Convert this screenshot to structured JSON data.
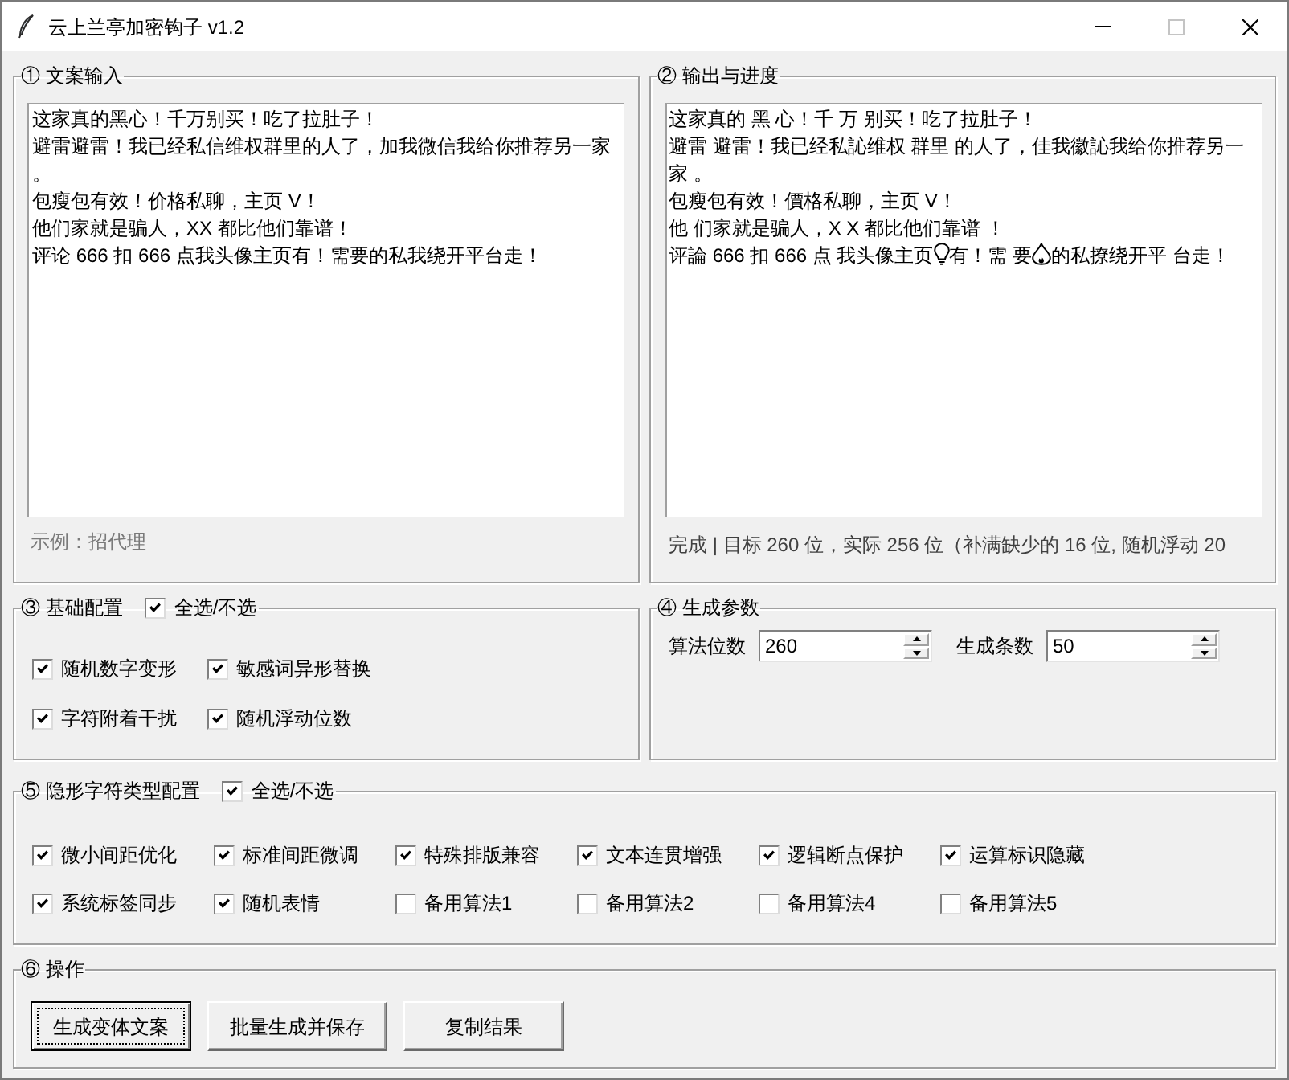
{
  "window": {
    "title": "云上兰亭加密钩子 v1.2",
    "controls": [
      {
        "kind": "minimize",
        "disabled": false
      },
      {
        "kind": "maximize",
        "disabled": true
      },
      {
        "kind": "close",
        "disabled": false
      }
    ]
  },
  "input_frame": {
    "title": "① 文案输入",
    "lines": [
      "这家真的黑心！千万别买！吃了拉肚子！",
      "避雷避雷！我已经私信维权群里的人了，加我微信我给你推荐另一家",
      "。",
      "包瘦包有效！价格私聊，主页 V！",
      "他们家就是骗人，XX 都比他们靠谱！",
      "评论 666 扣 666 点我头像主页有！需要的私我绕开平台走！"
    ],
    "hint": "示例：招代理"
  },
  "output_frame": {
    "title": "② 输出与进度",
    "lines": [
      [
        {
          "kind": "text",
          "text": "这家真的 黑 心！千 万 别买！吃了拉肚子！"
        }
      ],
      [
        {
          "kind": "text",
          "text": "避雷 避雷！我已经私訫维权 群里 的人了，佳我徽訫我给你推荐另一"
        }
      ],
      [
        {
          "kind": "text",
          "text": "家 。"
        }
      ],
      [
        {
          "kind": "text",
          "text": "包瘦包有效！價格私聊，主页 V！"
        }
      ],
      [
        {
          "kind": "text",
          "text": "他 们家就是骗人，X X 都比他们靠谱 ！"
        }
      ],
      [
        {
          "kind": "text",
          "text": "评論 666 扣 666 点 我头像主页"
        },
        {
          "kind": "emoji"
        },
        {
          "kind": "text",
          "text": "有！需 要"
        },
        {
          "kind": "emoji"
        },
        {
          "kind": "text",
          "text": "的私撩绕开平 台走！"
        }
      ]
    ],
    "status": "完成 | 目标 260 位，实际 256 位（补满缺少的 16 位, 随机浮动 20"
  },
  "basic_config": {
    "title": "③ 基础配置",
    "select_all": {
      "label": "全选/不选",
      "checked": true
    },
    "options": [
      {
        "label": "随机数字变形",
        "checked": true
      },
      {
        "label": "敏感词异形替换",
        "checked": true
      },
      {
        "label": "字符附着干扰",
        "checked": true
      },
      {
        "label": "随机浮动位数",
        "checked": true
      }
    ]
  },
  "params": {
    "title": "④ 生成参数",
    "fields": [
      {
        "label": "算法位数",
        "value": "260"
      },
      {
        "label": "生成条数",
        "value": "50"
      }
    ]
  },
  "invisible_config": {
    "title": "⑤ 隐形字符类型配置",
    "select_all": {
      "label": "全选/不选",
      "checked": true
    },
    "options": [
      {
        "label": "微小间距优化",
        "checked": true
      },
      {
        "label": "标准间距微调",
        "checked": true
      },
      {
        "label": "特殊排版兼容",
        "checked": true
      },
      {
        "label": "文本连贯增强",
        "checked": true
      },
      {
        "label": "逻辑断点保护",
        "checked": true
      },
      {
        "label": "运算标识隐藏",
        "checked": true
      },
      {
        "label": "系统标签同步",
        "checked": true
      },
      {
        "label": "随机表情",
        "checked": true
      },
      {
        "label": "备用算法1",
        "checked": false
      },
      {
        "label": "备用算法2",
        "checked": false
      },
      {
        "label": "备用算法4",
        "checked": false
      },
      {
        "label": "备用算法5",
        "checked": false
      }
    ]
  },
  "actions": {
    "title": "⑥ 操作",
    "buttons": [
      {
        "label": "生成变体文案",
        "focused": true
      },
      {
        "label": "批量生成并保存",
        "focused": false
      },
      {
        "label": "复制结果",
        "focused": false
      }
    ]
  }
}
